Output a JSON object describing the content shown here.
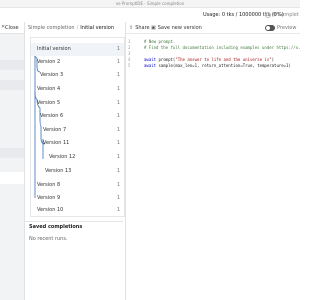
{
  "window": {
    "title": "ve PromptIDE - Simple completion"
  },
  "topbar": {
    "usage": "Usage: 0 tks / 1000000 tks (0%)",
    "status": "0 Complet"
  },
  "left_panel": {
    "close_label": "Close"
  },
  "breadcrumb": {
    "parent": "Simple completion",
    "separator": "/",
    "current": "Initial version"
  },
  "toolbar": {
    "share_label": "Share",
    "save_label": "Save new version",
    "preview_label": "Preview"
  },
  "versions": [
    {
      "label": "Initial version",
      "count": "1",
      "selected": true
    },
    {
      "label": "Version 2",
      "count": "1"
    },
    {
      "label": "Version 3",
      "count": "1"
    },
    {
      "label": "Version 4",
      "count": "1"
    },
    {
      "label": "Version 5",
      "count": "1"
    },
    {
      "label": "Version 6",
      "count": "1"
    },
    {
      "label": "Version 7",
      "count": "1"
    },
    {
      "label": "Version 11",
      "count": "1"
    },
    {
      "label": "Version 12",
      "count": "1"
    },
    {
      "label": "Version 13",
      "count": "1"
    },
    {
      "label": "Version 8",
      "count": "1"
    },
    {
      "label": "Version 9",
      "count": "1"
    },
    {
      "label": "Version 10",
      "count": "1"
    }
  ],
  "saved": {
    "header": "Saved completions",
    "empty": "No recent runs."
  },
  "editor": {
    "line_numbers": [
      "1",
      "2",
      "3",
      "4",
      "5"
    ],
    "line1": "# New prompt.",
    "line2": "# Find the full documentation including examples under https://x.",
    "line4_kw": "await",
    "line4_fn": " prompt(",
    "line4_str": "\"The answer to life and the universe is\"",
    "line4_end": ")",
    "line5_kw": "await",
    "line5_rest": " sample(max_len=1, return_attention=True, temperature=1)"
  },
  "colors": {
    "accent": "#3b6fb6",
    "selected_row": "#f0f3f7",
    "comment": "#3b7a3b",
    "keyword": "#0000cc",
    "string": "#a31515"
  }
}
